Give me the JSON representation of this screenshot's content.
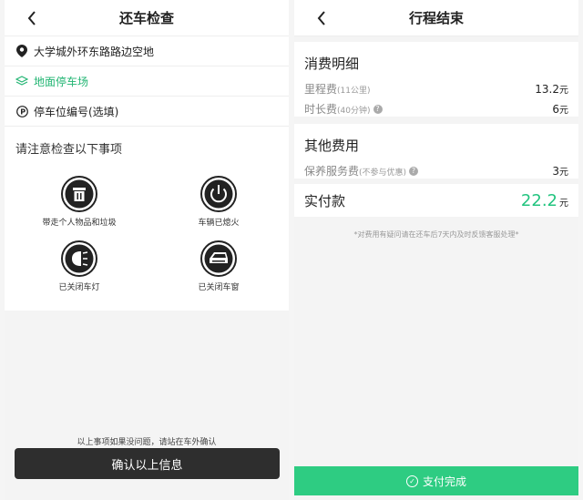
{
  "left": {
    "title": "还车检查",
    "location": "大学城外环东路路边空地",
    "parking_type": "地面停车场",
    "parking_number": "停车位编号(选填)",
    "notice": "请注意检查以下事项",
    "checks": [
      {
        "label": "带走个人物品和垃圾",
        "icon": "trash-icon"
      },
      {
        "label": "车辆已熄火",
        "icon": "power-icon"
      },
      {
        "label": "已关闭车灯",
        "icon": "headlight-icon"
      },
      {
        "label": "已关闭车窗",
        "icon": "car-window-icon"
      }
    ],
    "hint": "以上事项如果没问题，请站在车外确认",
    "confirm_label": "确认以上信息"
  },
  "right": {
    "title": "行程结束",
    "consumption": {
      "title": "消费明细",
      "mileage_label": "里程费",
      "mileage_note": "(11公里)",
      "mileage_amount": "13.2",
      "duration_label": "时长费",
      "duration_note": "(40分钟)",
      "duration_amount": "6"
    },
    "other": {
      "title": "其他费用",
      "service_label": "保养服务费",
      "service_note": "(不参与优惠)",
      "service_amount": "3"
    },
    "paid": {
      "label": "实付款",
      "amount": "22.2"
    },
    "currency": "元",
    "disclaimer": "*对费用有疑问请在还车后7天内及时反馈客服处理*",
    "pay_label": "支付完成"
  },
  "colors": {
    "accent": "#2ecc82",
    "paid_amount": "#22c47f",
    "confirm_bg": "#2e2e2e"
  }
}
